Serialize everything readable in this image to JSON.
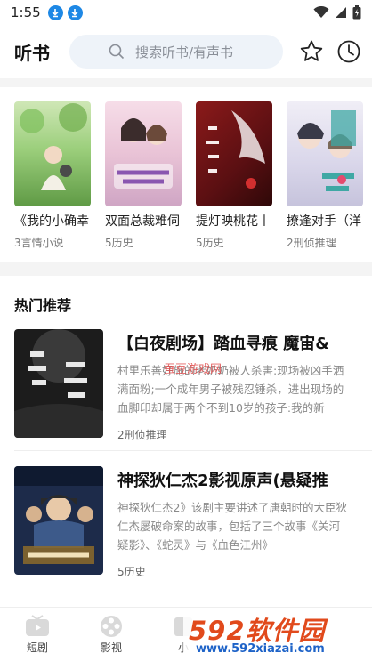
{
  "status_bar": {
    "time": "1:55"
  },
  "header": {
    "title": "听书",
    "search_placeholder": "搜索听书/有声书"
  },
  "shelf": {
    "items": [
      {
        "title": "《我的小确幸",
        "subtitle": "3言情小说"
      },
      {
        "title": "双面总裁难伺",
        "subtitle": "5历史"
      },
      {
        "title": "提灯映桃花丨",
        "subtitle": "5历史"
      },
      {
        "title": "撩逢对手（洋",
        "subtitle": "2刑侦推理"
      }
    ]
  },
  "hot": {
    "heading": "热门推荐",
    "items": [
      {
        "title": "【白夜剧场】踏血寻痕 魔宙&",
        "desc": "村里乐善好施的老奶奶被人杀害:现场被凶手洒满面粉;一个成年男子被残忍锤杀，进出现场的血脚印却属于两个不到10岁的孩子:我的新",
        "meta": "2刑侦推理"
      },
      {
        "title": "神探狄仁杰2影视原声(悬疑推",
        "desc": "神探狄仁杰2》该剧主要讲述了唐朝时的大臣狄仁杰屡破命案的故事，包括了三个故事《关河疑影》、《蛇灵》与《血色江州》",
        "meta": "5历史"
      }
    ]
  },
  "tabbar": {
    "tabs": [
      {
        "label": "短剧"
      },
      {
        "label": "影视"
      },
      {
        "label": "小"
      }
    ]
  },
  "watermark": {
    "logo": "592软件园",
    "url": "www.592xiazai.com",
    "overlay": "蚕豆游戏网"
  }
}
